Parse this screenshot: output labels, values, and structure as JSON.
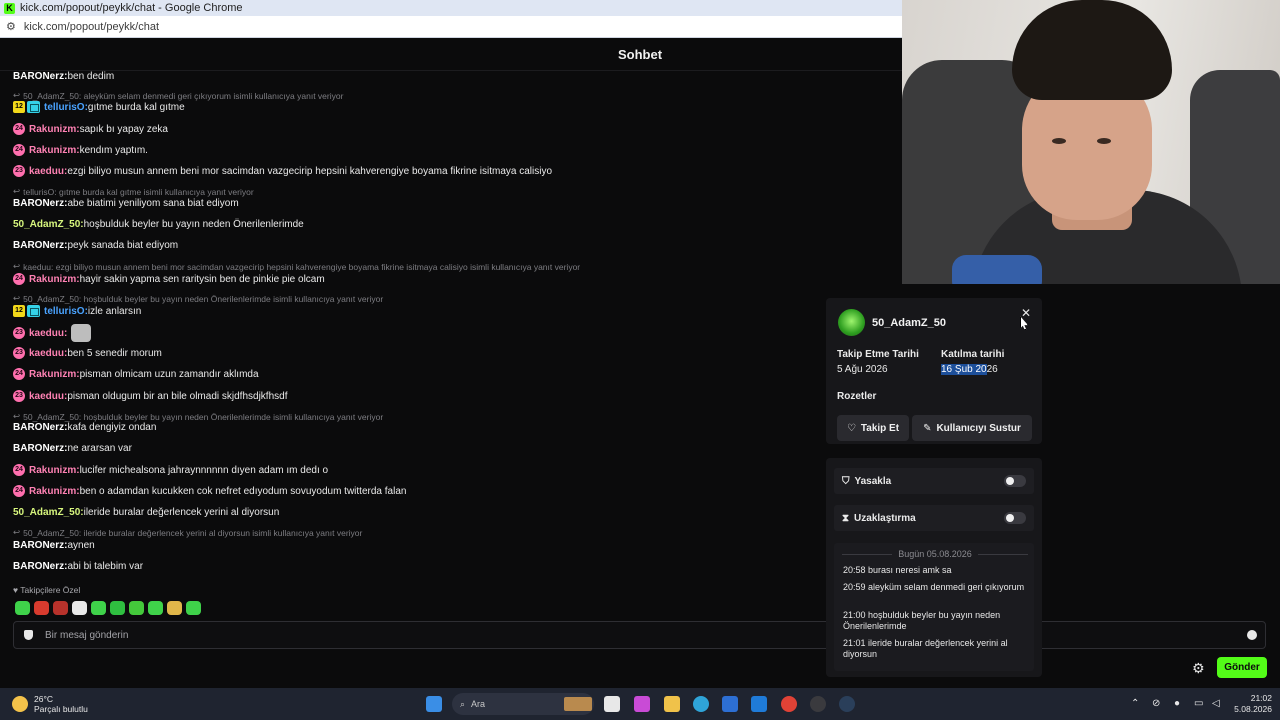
{
  "browser": {
    "window_title": "kick.com/popout/peykk/chat - Google Chrome",
    "url": "kick.com/popout/peykk/chat"
  },
  "chat": {
    "header": "Sohbet",
    "colors": {
      "BARONerz": "#ffffff",
      "50_AdamZ_50": "#d8f77e",
      "tellurisO": "#4aa3ff",
      "Rakunizm": "#ff82b4",
      "kaeduu": "#ff82b4"
    },
    "messages": [
      {
        "kind": "msg",
        "user": "BARONerz",
        "text": " ben dedim"
      },
      {
        "kind": "reply",
        "text": "50_AdamZ_50: aleyküm selam denmedi geri çıkıyorum isimli kullanıcıya yanıt veriyor"
      },
      {
        "kind": "msg",
        "badge": "12",
        "user": "tellurisO",
        "text": " gıtme burda kal gıtme"
      },
      {
        "kind": "msg",
        "badge": "24",
        "user": "Rakunizm",
        "text": " sapık bı yapay zeka"
      },
      {
        "kind": "msg",
        "badge": "24",
        "user": "Rakunizm",
        "text": " kendım yaptım."
      },
      {
        "kind": "msg",
        "badge": "23",
        "user": "kaeduu",
        "text": " ezgi biliyo musun annem beni mor sacimdan vazgecirip hepsini kahverengiye boyama fikrine isitmaya calisiyo"
      },
      {
        "kind": "reply",
        "text": "tellurisO: gıtme burda kal gıtme isimli kullanıcıya yanıt veriyor"
      },
      {
        "kind": "msg",
        "user": "BARONerz",
        "text": " abe biatimi yeniliyom sana biat ediyom"
      },
      {
        "kind": "msg",
        "user": "50_AdamZ_50",
        "text": " hoşbulduk beyler bu yayın neden Önerilenlerimde"
      },
      {
        "kind": "msg",
        "user": "BARONerz",
        "text": " peyk sanada biat ediyom"
      },
      {
        "kind": "reply",
        "text": "kaeduu: ezgi biliyo musun annem beni mor sacimdan vazgecirip hepsini kahverengiye boyama fikrine isitmaya calisiyo isimli kullanıcıya yanıt veriyor"
      },
      {
        "kind": "msg",
        "badge": "24",
        "user": "Rakunizm",
        "text": " hayir sakin yapma sen raritysin ben de pinkie pie olcam"
      },
      {
        "kind": "reply",
        "text": "50_AdamZ_50: hoşbulduk beyler bu yayın neden Önerilenlerimde isimli kullanıcıya yanıt veriyor"
      },
      {
        "kind": "msg",
        "badge": "12",
        "user": "tellurisO",
        "text": " izle anlarsın"
      },
      {
        "kind": "msg",
        "badge": "23",
        "user": "kaeduu",
        "text": "",
        "emote": "cat-emote"
      },
      {
        "kind": "msg",
        "badge": "23",
        "user": "kaeduu",
        "text": " ben 5 senedir morum"
      },
      {
        "kind": "msg",
        "badge": "24",
        "user": "Rakunizm",
        "text": " pisman olmicam uzun zamandır aklımda"
      },
      {
        "kind": "msg",
        "badge": "23",
        "user": "kaeduu",
        "text": " pisman oldugum bir an bile olmadi skjdfhsdjkfhsdf"
      },
      {
        "kind": "reply",
        "text": "50_AdamZ_50: hoşbulduk beyler bu yayın neden Önerilenlerimde isimli kullanıcıya yanıt veriyor"
      },
      {
        "kind": "msg",
        "user": "BARONerz",
        "text": " kafa dengiyiz ondan"
      },
      {
        "kind": "msg",
        "user": "BARONerz",
        "text": " ne ararsan var"
      },
      {
        "kind": "msg",
        "badge": "24",
        "user": "Rakunizm",
        "text": " lucifer michealsona jahraynnnnnn dıyen adam ım dedı o"
      },
      {
        "kind": "msg",
        "badge": "24",
        "user": "Rakunizm",
        "text": " ben o adamdan kucukken cok nefret edıyodum sovuyodum twitterda falan"
      },
      {
        "kind": "msg",
        "user": "50_AdamZ_50",
        "text": " ileride buralar değerlencek yerini al diyorsun"
      },
      {
        "kind": "reply",
        "text": "50_AdamZ_50: ileride buralar değerlencek yerini al diyorsun isimli kullanıcıya yanıt veriyor"
      },
      {
        "kind": "msg",
        "user": "BARONerz",
        "text": " aynen"
      },
      {
        "kind": "msg",
        "user": "BARONerz",
        "text": " abi bi talebim var"
      }
    ],
    "followers_only": "Takipçilere Özel",
    "input_placeholder": "Bir mesaj gönderin",
    "send_label": "Gönder"
  },
  "user_card": {
    "username": "50_AdamZ_50",
    "follow_date_label": "Takip Etme Tarihi",
    "follow_date": "5 Ağu 2026",
    "join_date_label": "Katılma tarihi",
    "join_date_selected": "16 Şub 20",
    "join_date_rest": "26",
    "badges_label": "Rozetler",
    "follow_button": "Takip Et",
    "mute_button": "Kullanıcıyı Sustur",
    "ban_label": "Yasakla",
    "timeout_label": "Uzaklaştırma",
    "history_header": "Bugün 05.08.2026",
    "history": [
      "20:58 burası neresi amk sa",
      "20:59 aleyküm selam denmedi geri çıkıyorum",
      "21:00 hoşbulduk beyler bu yayın neden Önerilenlerimde",
      "21:01 ileride buralar değerlencek yerini al diyorsun"
    ]
  },
  "taskbar": {
    "temperature": "26°C",
    "weather": "Parçalı bulutlu",
    "search_placeholder": "Ara",
    "time": "21:02",
    "date": "5.08.2026"
  }
}
